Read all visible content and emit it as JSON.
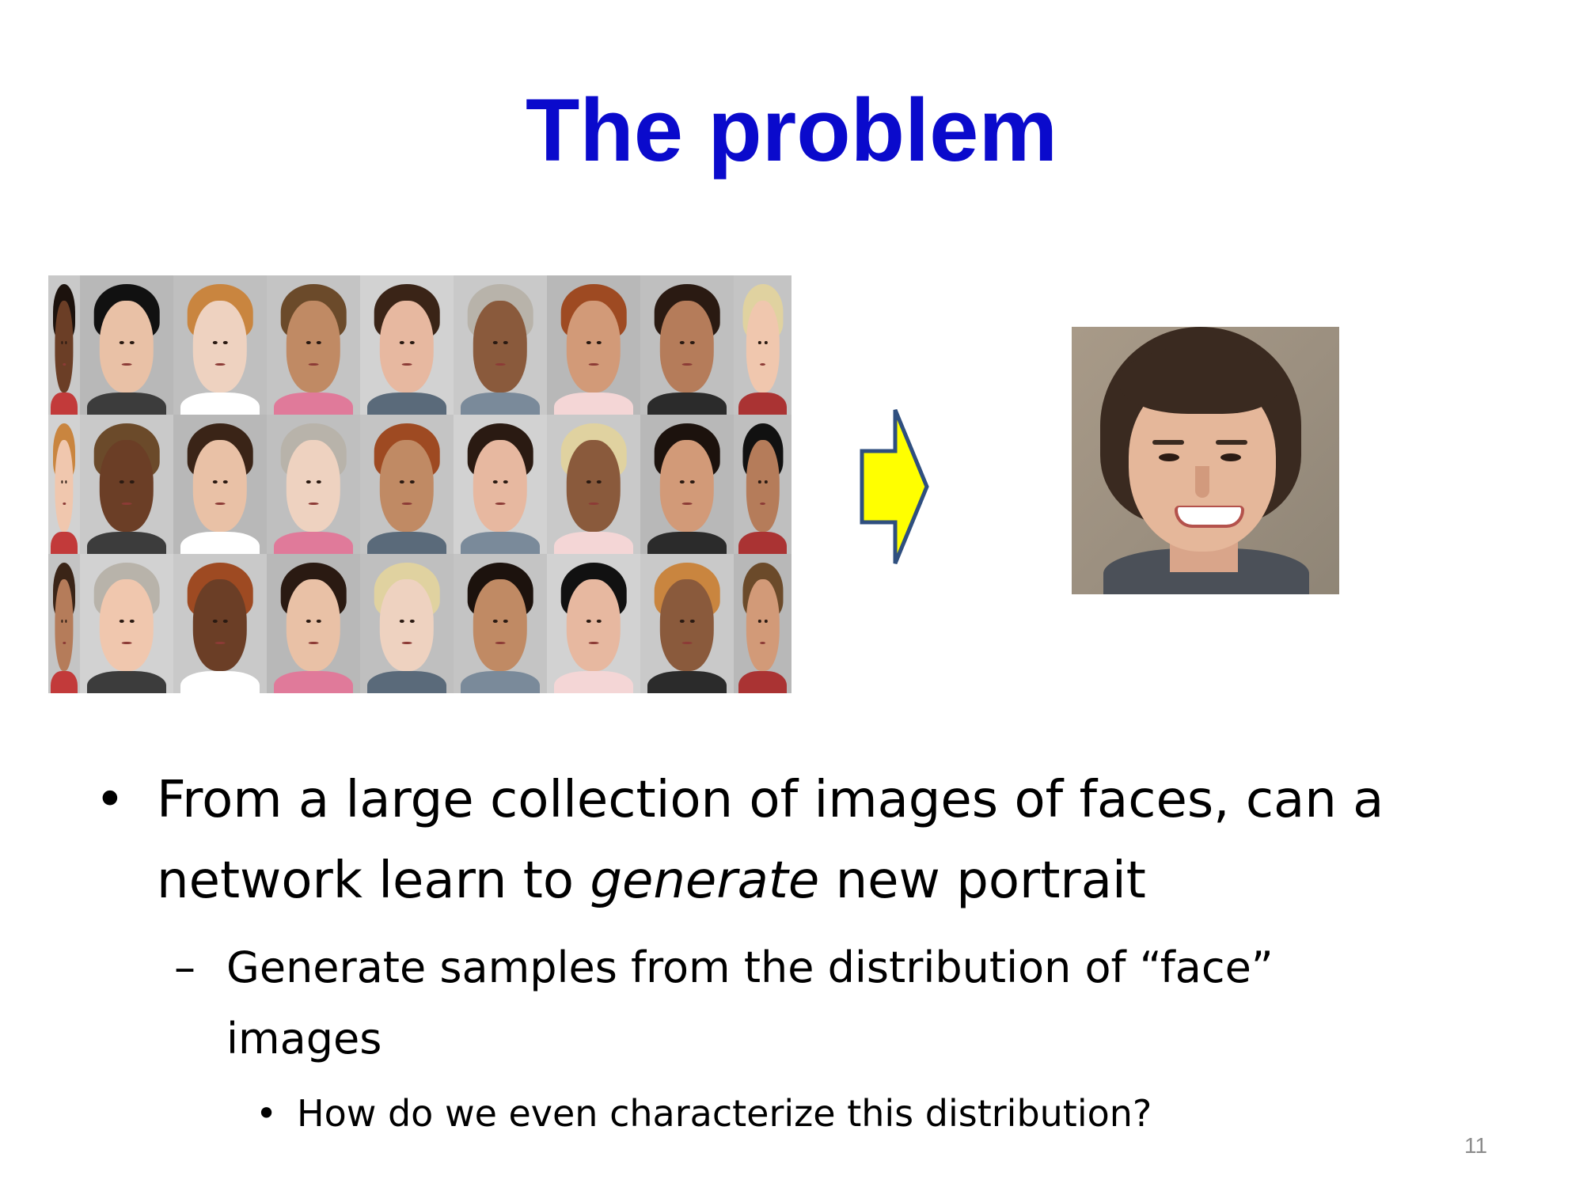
{
  "slide": {
    "title": "The problem",
    "page_number": "11",
    "bullets": {
      "level1_before_em": "From a large collection of images of faces, can a network learn to ",
      "level1_em": "generate",
      "level1_after_em": " new portrait",
      "level2": "Generate samples from the distribution of “face” images",
      "level3": "How do we even characterize this distribution?"
    }
  },
  "colors": {
    "title": "#0a0acc",
    "arrow_fill": "#ffff00",
    "arrow_stroke": "#2f4f7f"
  },
  "icons": {
    "arrow": "right-arrow-icon",
    "bullet": "bullet-dot",
    "dash": "en-dash"
  }
}
